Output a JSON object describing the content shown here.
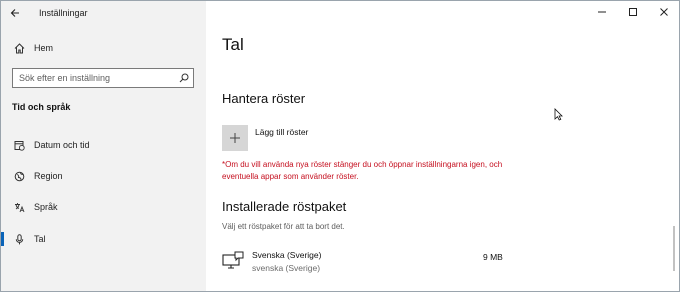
{
  "window": {
    "title": "Inställningar"
  },
  "sidebar": {
    "home_label": "Hem",
    "search_placeholder": "Sök efter en inställning",
    "section_title": "Tid och språk",
    "items": [
      {
        "label": "Datum och tid",
        "icon": "calendar-clock-icon"
      },
      {
        "label": "Region",
        "icon": "globe-icon"
      },
      {
        "label": "Språk",
        "icon": "language-icon"
      },
      {
        "label": "Tal",
        "icon": "microphone-icon",
        "active": true
      }
    ]
  },
  "main": {
    "title": "Tal",
    "manage_voices": {
      "heading": "Hantera röster",
      "add_label": "Lägg till röster",
      "warning": "*Om du vill använda nya röster stänger du och öppnar inställningarna igen, och eventuella appar som använder röster."
    },
    "installed": {
      "heading": "Installerade röstpaket",
      "subtitle": "Välj ett röstpaket för att ta bort det.",
      "packages": [
        {
          "name": "Svenska (Sverige)",
          "detail": "svenska (Sverige)",
          "size": "9 MB"
        }
      ]
    }
  },
  "colors": {
    "warning": "#c50f1f",
    "accent": "#0a63b8"
  }
}
